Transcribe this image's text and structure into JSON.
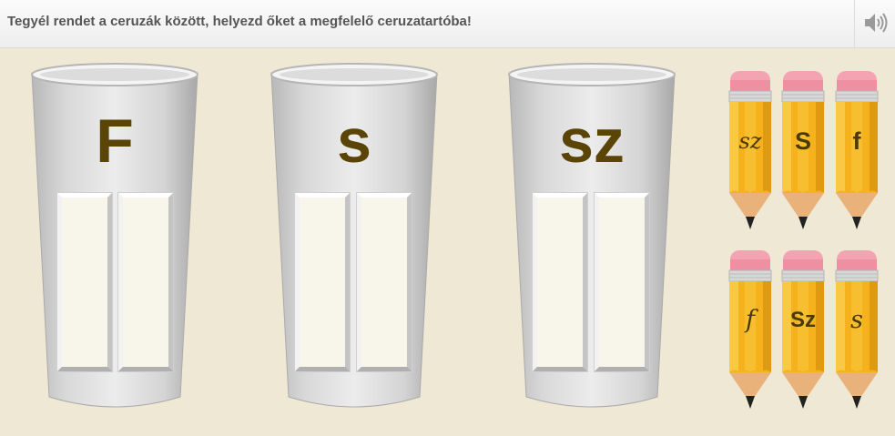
{
  "instruction": "Tegyél rendet a ceruzák között, helyezd őket a megfelelő ceruzatartóba!",
  "sound_icon": "speaker-icon",
  "cups": [
    {
      "letter": "F"
    },
    {
      "letter": "s"
    },
    {
      "letter": "sz"
    }
  ],
  "pencils": [
    {
      "label": "sz",
      "style": "script"
    },
    {
      "label": "S",
      "style": "print"
    },
    {
      "label": "f",
      "style": "print"
    },
    {
      "label": "f",
      "style": "script"
    },
    {
      "label": "Sz",
      "style": "print"
    },
    {
      "label": "s",
      "style": "script"
    }
  ],
  "colors": {
    "pencil_body": "#f5b21c",
    "eraser": "#f4a3b3",
    "letter": "#5a4507"
  }
}
